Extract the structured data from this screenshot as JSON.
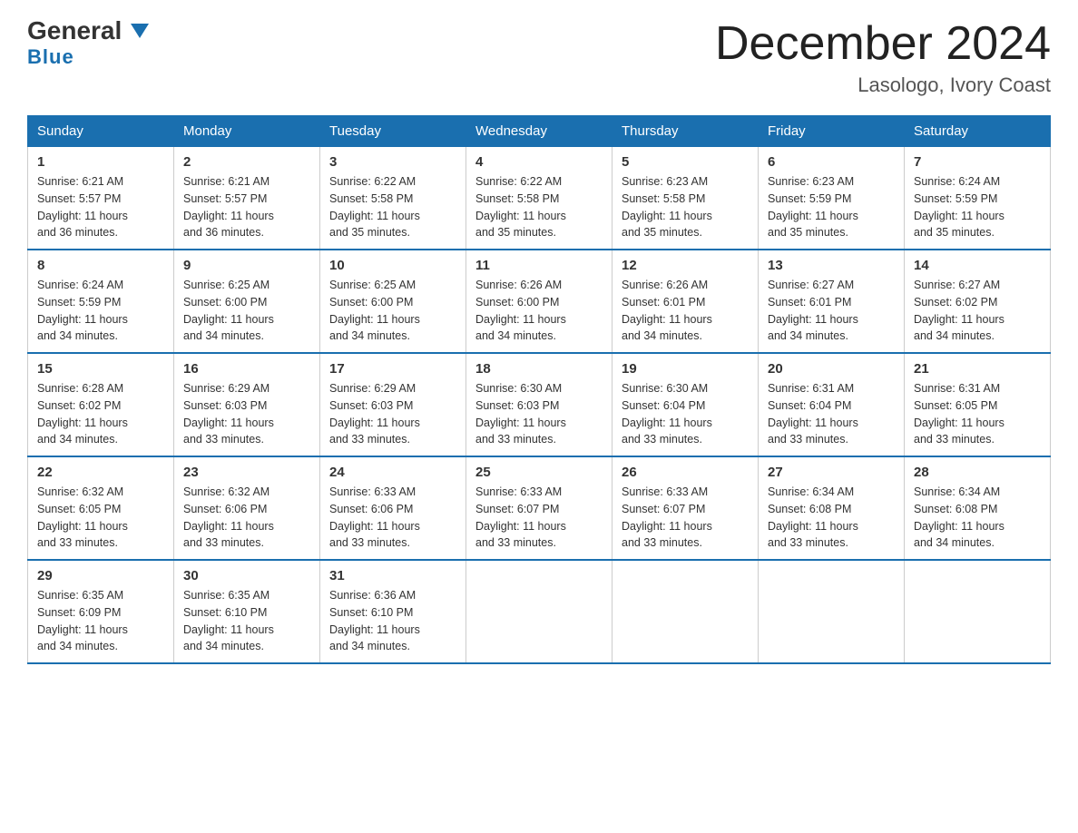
{
  "header": {
    "logo_general": "General",
    "logo_blue": "Blue",
    "month_title": "December 2024",
    "location": "Lasologo, Ivory Coast"
  },
  "days_of_week": [
    "Sunday",
    "Monday",
    "Tuesday",
    "Wednesday",
    "Thursday",
    "Friday",
    "Saturday"
  ],
  "weeks": [
    [
      {
        "day": "1",
        "sunrise": "6:21 AM",
        "sunset": "5:57 PM",
        "daylight": "11 hours and 36 minutes."
      },
      {
        "day": "2",
        "sunrise": "6:21 AM",
        "sunset": "5:57 PM",
        "daylight": "11 hours and 36 minutes."
      },
      {
        "day": "3",
        "sunrise": "6:22 AM",
        "sunset": "5:58 PM",
        "daylight": "11 hours and 35 minutes."
      },
      {
        "day": "4",
        "sunrise": "6:22 AM",
        "sunset": "5:58 PM",
        "daylight": "11 hours and 35 minutes."
      },
      {
        "day": "5",
        "sunrise": "6:23 AM",
        "sunset": "5:58 PM",
        "daylight": "11 hours and 35 minutes."
      },
      {
        "day": "6",
        "sunrise": "6:23 AM",
        "sunset": "5:59 PM",
        "daylight": "11 hours and 35 minutes."
      },
      {
        "day": "7",
        "sunrise": "6:24 AM",
        "sunset": "5:59 PM",
        "daylight": "11 hours and 35 minutes."
      }
    ],
    [
      {
        "day": "8",
        "sunrise": "6:24 AM",
        "sunset": "5:59 PM",
        "daylight": "11 hours and 34 minutes."
      },
      {
        "day": "9",
        "sunrise": "6:25 AM",
        "sunset": "6:00 PM",
        "daylight": "11 hours and 34 minutes."
      },
      {
        "day": "10",
        "sunrise": "6:25 AM",
        "sunset": "6:00 PM",
        "daylight": "11 hours and 34 minutes."
      },
      {
        "day": "11",
        "sunrise": "6:26 AM",
        "sunset": "6:00 PM",
        "daylight": "11 hours and 34 minutes."
      },
      {
        "day": "12",
        "sunrise": "6:26 AM",
        "sunset": "6:01 PM",
        "daylight": "11 hours and 34 minutes."
      },
      {
        "day": "13",
        "sunrise": "6:27 AM",
        "sunset": "6:01 PM",
        "daylight": "11 hours and 34 minutes."
      },
      {
        "day": "14",
        "sunrise": "6:27 AM",
        "sunset": "6:02 PM",
        "daylight": "11 hours and 34 minutes."
      }
    ],
    [
      {
        "day": "15",
        "sunrise": "6:28 AM",
        "sunset": "6:02 PM",
        "daylight": "11 hours and 34 minutes."
      },
      {
        "day": "16",
        "sunrise": "6:29 AM",
        "sunset": "6:03 PM",
        "daylight": "11 hours and 33 minutes."
      },
      {
        "day": "17",
        "sunrise": "6:29 AM",
        "sunset": "6:03 PM",
        "daylight": "11 hours and 33 minutes."
      },
      {
        "day": "18",
        "sunrise": "6:30 AM",
        "sunset": "6:03 PM",
        "daylight": "11 hours and 33 minutes."
      },
      {
        "day": "19",
        "sunrise": "6:30 AM",
        "sunset": "6:04 PM",
        "daylight": "11 hours and 33 minutes."
      },
      {
        "day": "20",
        "sunrise": "6:31 AM",
        "sunset": "6:04 PM",
        "daylight": "11 hours and 33 minutes."
      },
      {
        "day": "21",
        "sunrise": "6:31 AM",
        "sunset": "6:05 PM",
        "daylight": "11 hours and 33 minutes."
      }
    ],
    [
      {
        "day": "22",
        "sunrise": "6:32 AM",
        "sunset": "6:05 PM",
        "daylight": "11 hours and 33 minutes."
      },
      {
        "day": "23",
        "sunrise": "6:32 AM",
        "sunset": "6:06 PM",
        "daylight": "11 hours and 33 minutes."
      },
      {
        "day": "24",
        "sunrise": "6:33 AM",
        "sunset": "6:06 PM",
        "daylight": "11 hours and 33 minutes."
      },
      {
        "day": "25",
        "sunrise": "6:33 AM",
        "sunset": "6:07 PM",
        "daylight": "11 hours and 33 minutes."
      },
      {
        "day": "26",
        "sunrise": "6:33 AM",
        "sunset": "6:07 PM",
        "daylight": "11 hours and 33 minutes."
      },
      {
        "day": "27",
        "sunrise": "6:34 AM",
        "sunset": "6:08 PM",
        "daylight": "11 hours and 33 minutes."
      },
      {
        "day": "28",
        "sunrise": "6:34 AM",
        "sunset": "6:08 PM",
        "daylight": "11 hours and 34 minutes."
      }
    ],
    [
      {
        "day": "29",
        "sunrise": "6:35 AM",
        "sunset": "6:09 PM",
        "daylight": "11 hours and 34 minutes."
      },
      {
        "day": "30",
        "sunrise": "6:35 AM",
        "sunset": "6:10 PM",
        "daylight": "11 hours and 34 minutes."
      },
      {
        "day": "31",
        "sunrise": "6:36 AM",
        "sunset": "6:10 PM",
        "daylight": "11 hours and 34 minutes."
      },
      null,
      null,
      null,
      null
    ]
  ],
  "labels": {
    "sunrise": "Sunrise:",
    "sunset": "Sunset:",
    "daylight": "Daylight:"
  }
}
